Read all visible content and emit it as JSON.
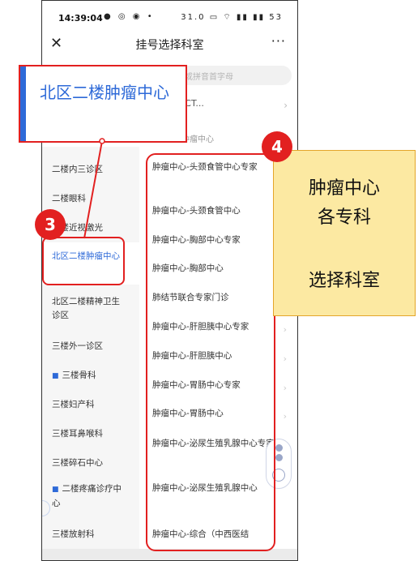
{
  "status_bar": {
    "time": "14:39:04",
    "left_icons": "● ◎ ◉ •",
    "right_icons": "31.0 ▭ ⌔ ▮▮ ▮▮ 53"
  },
  "nav": {
    "close": "✕",
    "title": "挂号选择科室",
    "more": "···"
  },
  "search": {
    "placeholder": "或拼音首字母"
  },
  "top_item": {
    "label": "(CT...",
    "chevron": "›"
  },
  "group_label": "肿瘤中心",
  "sidebar": {
    "items": [
      {
        "label": "二楼内三诊区"
      },
      {
        "label": "二楼眼科"
      },
      {
        "label": "二楼近视激光"
      },
      {
        "label": "北区二楼肿瘤中心"
      },
      {
        "label": "北区二楼精神卫生诊区"
      },
      {
        "label": "三楼外一诊区"
      },
      {
        "label": "三楼骨科",
        "flag": "■"
      },
      {
        "label": "三楼妇产科"
      },
      {
        "label": "三楼耳鼻喉科"
      },
      {
        "label": "三楼碎石中心"
      },
      {
        "label": "二楼疼痛诊疗中心",
        "flag": "■"
      },
      {
        "label": "三楼放射科"
      }
    ]
  },
  "departments": [
    {
      "label": "肿瘤中心-头颈食管中心专家"
    },
    {
      "label": "肿瘤中心-头颈食管中心"
    },
    {
      "label": "肿瘤中心-胸部中心专家"
    },
    {
      "label": "肿瘤中心-胸部中心"
    },
    {
      "label": "肺结节联合专家门诊"
    },
    {
      "label": "肿瘤中心-肝胆胰中心专家"
    },
    {
      "label": "肿瘤中心-肝胆胰中心"
    },
    {
      "label": "肿瘤中心-胃肠中心专家"
    },
    {
      "label": "肿瘤中心-胃肠中心"
    },
    {
      "label": "肿瘤中心-泌尿生殖乳腺中心专家"
    },
    {
      "label": "肿瘤中心-泌尿生殖乳腺中心"
    },
    {
      "label": "肿瘤中心-综合（中西医结"
    }
  ],
  "chevron": "›",
  "zoom_callout": {
    "text": "北区二楼肿瘤中心"
  },
  "badges": {
    "step3": "3",
    "step4": "4"
  },
  "note": {
    "line1": "肿瘤中心",
    "line2": "各专科",
    "line3": "选择科室"
  },
  "colors": {
    "accent_blue": "#2e6ad8",
    "annotation_red": "#e22020",
    "note_bg": "#fce9a2",
    "note_border": "#e4a52a"
  }
}
